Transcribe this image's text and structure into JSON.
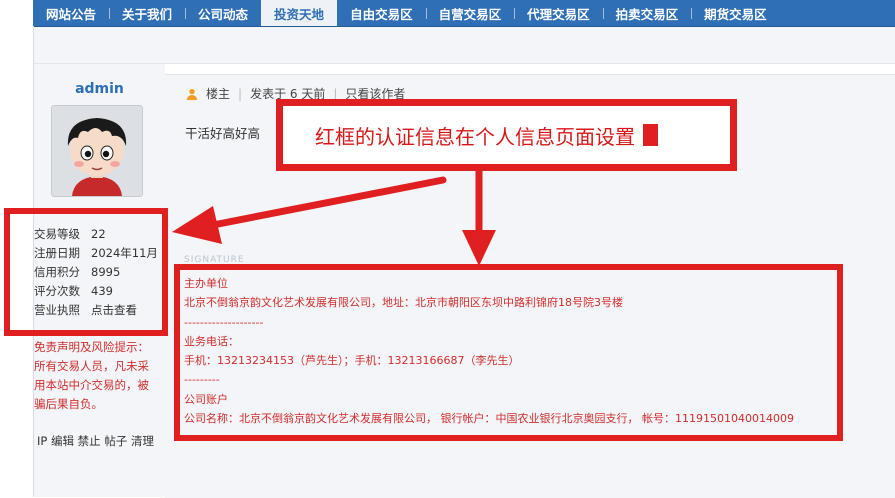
{
  "nav": {
    "items": [
      "网站公告",
      "关于我们",
      "公司动态",
      "投资天地",
      "自由交易区",
      "自营交易区",
      "代理交易区",
      "拍卖交易区",
      "期货交易区"
    ],
    "active": "投资天地"
  },
  "author": {
    "name": "admin"
  },
  "info": {
    "rows": [
      {
        "label": "交易等级",
        "value": "22"
      },
      {
        "label": "注册日期",
        "value": "2024年11月"
      },
      {
        "label": "信用积分",
        "value": "8995"
      },
      {
        "label": "评分次数",
        "value": "439"
      },
      {
        "label": "营业执照",
        "value": "点击查看"
      }
    ]
  },
  "disclaimer": {
    "lines": [
      "免责声明及风险提示：",
      "所有交易人员，凡未采",
      "用本站中介交易的，被",
      "骗后果自负。"
    ]
  },
  "admin_actions": [
    "IP",
    "编辑",
    "禁止",
    "帖子",
    "清理"
  ],
  "post": {
    "meta": {
      "role": "楼主",
      "posted": "发表于 6 天前",
      "only_author": "只看该作者"
    },
    "body": "干活好高好高"
  },
  "callout": {
    "text": "红框的认证信息在个人信息页面设置"
  },
  "signature": {
    "label": "SIGNATURE",
    "lines": [
      "主办单位",
      "北京不倒翁京韵文化艺术发展有限公司，地址：北京市朝阳区东坝中路利锦府18号院3号楼",
      "--------------------",
      "业务电话：",
      "手机：13213234153（芦先生）；手机：13213166687（李先生）",
      "---------",
      "公司账户",
      "公司名称：北京不倒翁京韵文化艺术发展有限公司， 银行帐户：中国农业银行北京奥园支行， 帐号：11191501040014009"
    ]
  },
  "colors": {
    "nav_bg": "#2f6fb5",
    "annotation_red": "#e02020",
    "signature_red": "#d22d2d",
    "panel_bg": "#f3f5f8"
  }
}
